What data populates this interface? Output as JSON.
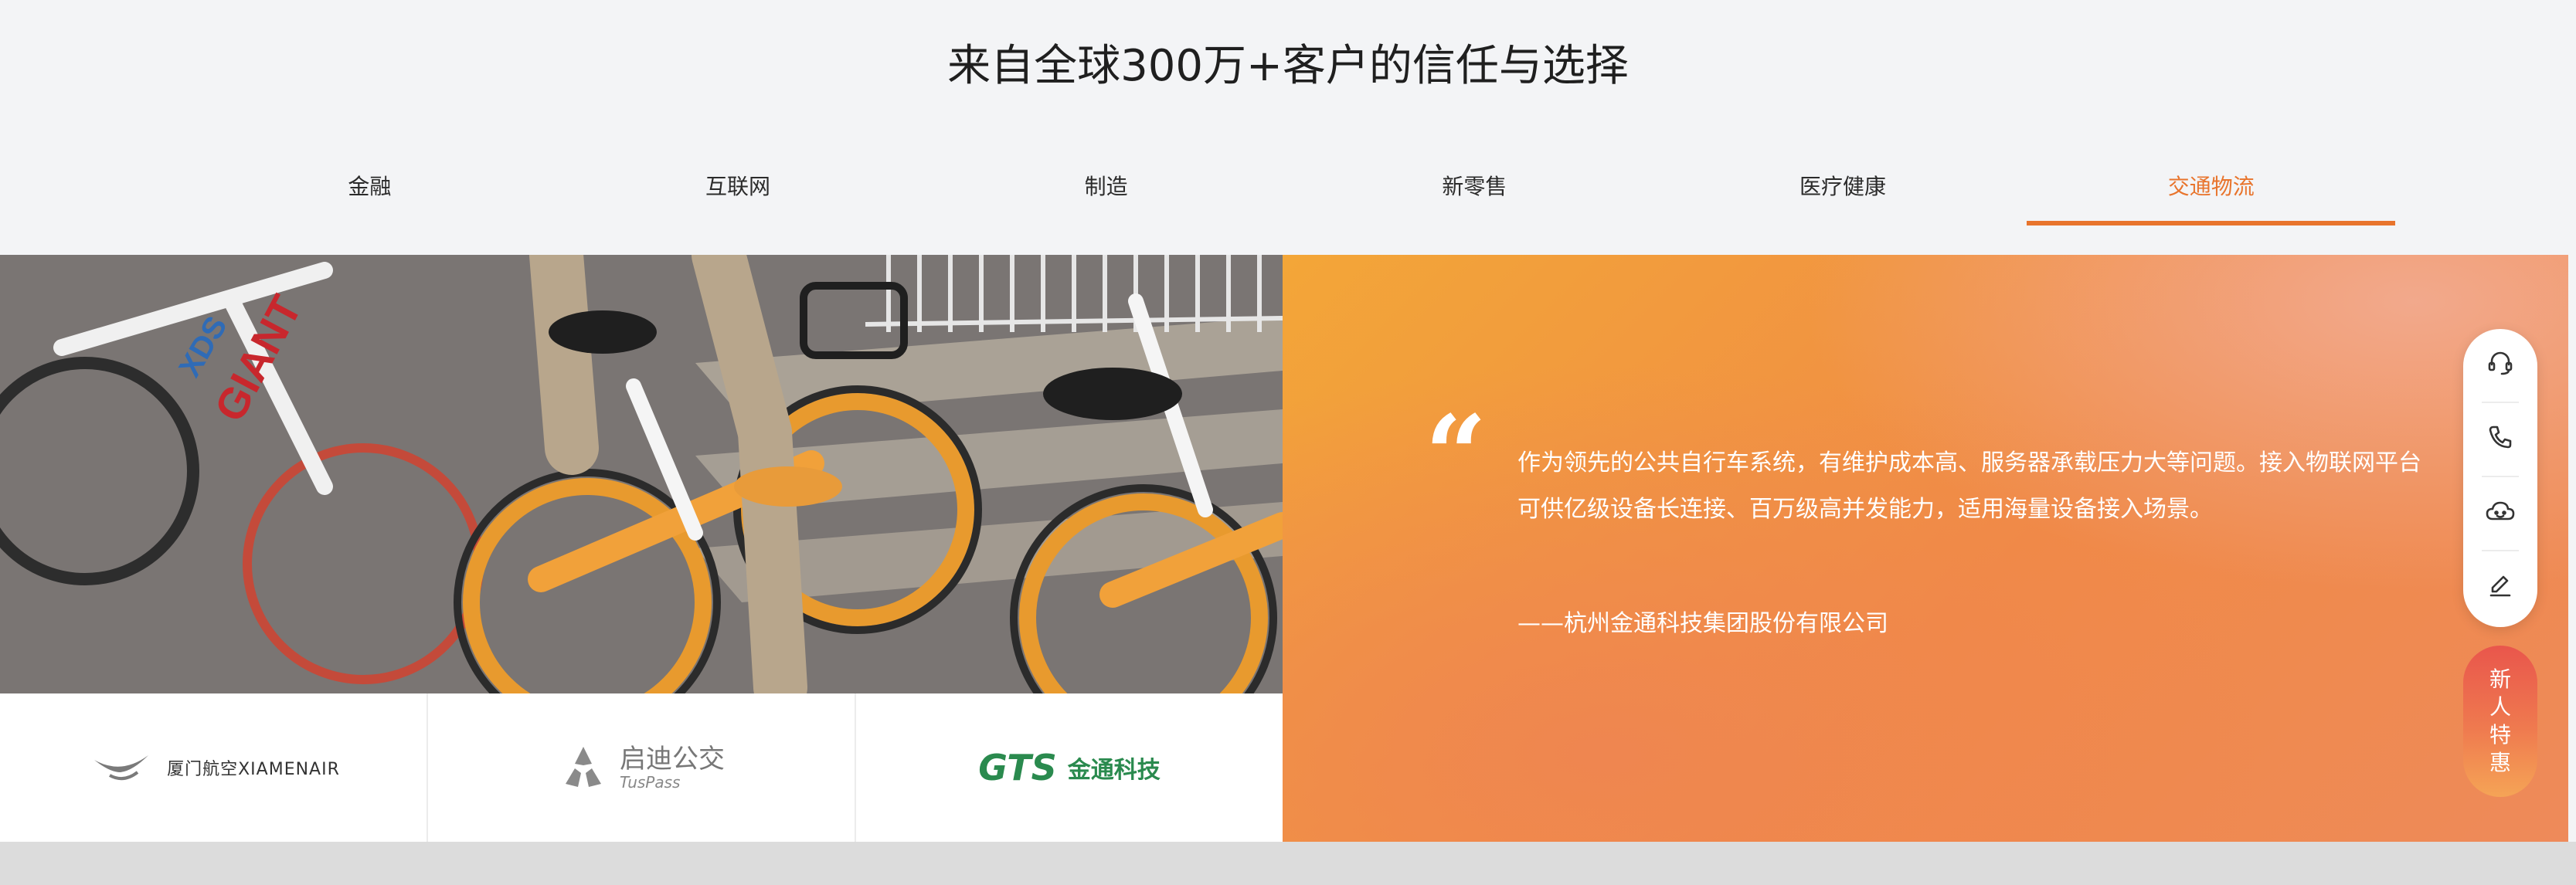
{
  "section": {
    "title": "来自全球300万+客户的信任与选择"
  },
  "tabs": [
    {
      "label": "金融"
    },
    {
      "label": "互联网"
    },
    {
      "label": "制造"
    },
    {
      "label": "新零售"
    },
    {
      "label": "医疗健康"
    },
    {
      "label": "交通物流",
      "active": true
    }
  ],
  "photo": {
    "bike_brand": "GIANT",
    "bike_model": "XDS"
  },
  "logos": [
    {
      "name": "厦门航空XIAMENAIR",
      "icon": "xiamen-air-logo"
    },
    {
      "name": "启迪公交",
      "sub": "TusPass",
      "icon": "tuspass-logo"
    },
    {
      "mark": "GTS",
      "name": "金通科技",
      "icon": "gts-logo"
    }
  ],
  "quote": {
    "mark": "“",
    "text": "作为领先的公共自行车系统，有维护成本高、服务器承载压力大等问题。接入物联网平台可供亿级设备长连接、百万级高并发能力，适用海量设备接入场景。",
    "author": "——杭州金通科技集团股份有限公司"
  },
  "float_bar": {
    "items": [
      {
        "icon": "headset-icon"
      },
      {
        "icon": "phone-icon"
      },
      {
        "icon": "cloud-chat-icon"
      },
      {
        "icon": "edit-icon"
      }
    ]
  },
  "promo": {
    "chars": [
      "新",
      "人",
      "特",
      "惠"
    ]
  },
  "colors": {
    "accent": "#e8742c",
    "gts_green": "#2a8a4e"
  }
}
